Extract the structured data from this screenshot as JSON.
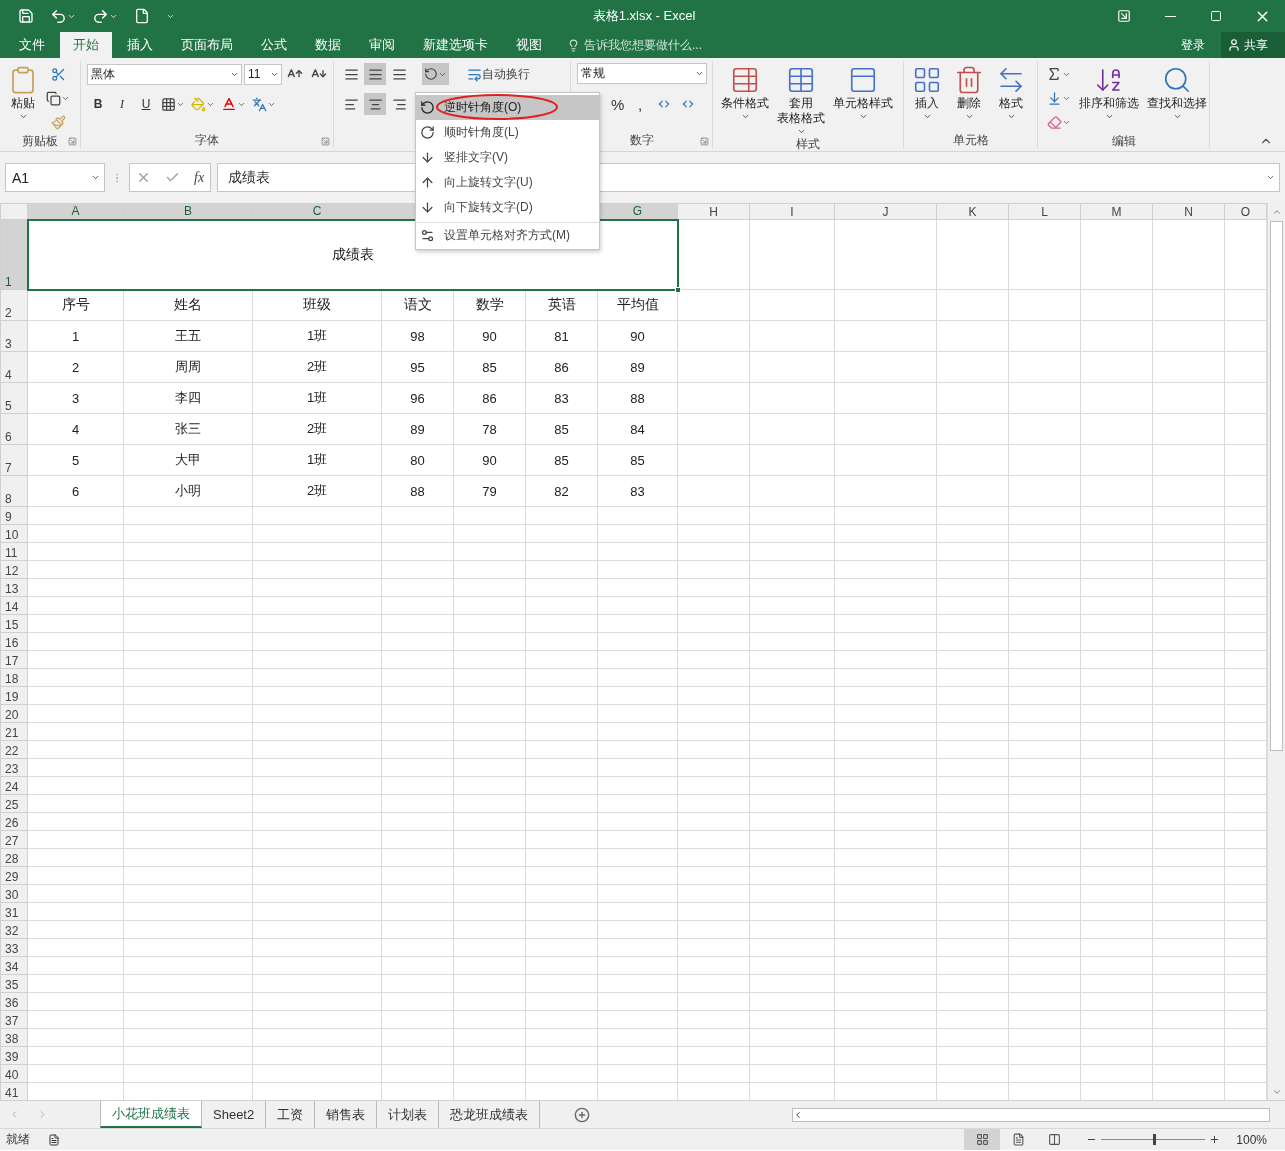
{
  "title_bar": {
    "title": "表格1.xlsx - Excel"
  },
  "menu_tabs": [
    {
      "label": "文件",
      "selected": false
    },
    {
      "label": "开始",
      "selected": true
    },
    {
      "label": "插入",
      "selected": false
    },
    {
      "label": "页面布局",
      "selected": false
    },
    {
      "label": "公式",
      "selected": false
    },
    {
      "label": "数据",
      "selected": false
    },
    {
      "label": "审阅",
      "selected": false
    },
    {
      "label": "新建选项卡",
      "selected": false
    },
    {
      "label": "视图",
      "selected": false
    }
  ],
  "tell_me": {
    "placeholder": "告诉我您想要做什么..."
  },
  "account": {
    "login": "登录",
    "share": "共享"
  },
  "ribbon": {
    "clipboard": {
      "paste": "粘贴",
      "label": "剪贴板"
    },
    "font": {
      "font_name": "黑体",
      "font_size": "11",
      "style_buttons": [
        "B",
        "I",
        "U"
      ],
      "label": "字体"
    },
    "alignment": {
      "vertical": [
        {
          "pressed": false
        },
        {
          "pressed": true
        },
        {
          "pressed": false
        }
      ],
      "horizontal": [
        {
          "pressed": false
        },
        {
          "pressed": true
        },
        {
          "pressed": false
        }
      ],
      "orientation_pressed": true,
      "wrap_text": "自动换行"
    },
    "number": {
      "format": "常规",
      "symbols": [
        "%",
        ","
      ],
      "label": "数字"
    },
    "styles": {
      "buttons": [
        {
          "kind": "conditional",
          "lines": [
            "条件格式"
          ]
        },
        {
          "kind": "table",
          "lines": [
            "套用",
            "表格格式"
          ]
        },
        {
          "kind": "cell",
          "lines": [
            "单元格样式"
          ]
        }
      ],
      "label": "样式"
    },
    "cells": {
      "buttons": [
        {
          "kind": "insert",
          "lines": [
            "插入"
          ]
        },
        {
          "kind": "delete",
          "lines": [
            "删除"
          ]
        },
        {
          "kind": "format",
          "lines": [
            "格式"
          ]
        }
      ],
      "label": "单元格"
    },
    "editing": {
      "buttons": [
        {
          "kind": "sort",
          "lines": [
            "排序和筛选"
          ]
        },
        {
          "kind": "find",
          "lines": [
            "查找和选择"
          ]
        }
      ],
      "label": "编辑"
    }
  },
  "formula_bar": {
    "name_box": "A1",
    "fx": "fx",
    "formula": "成绩表"
  },
  "orientation_menu": [
    {
      "kind": "ccw",
      "label": "逆时针角度(O)",
      "selected": true,
      "circled": true
    },
    {
      "kind": "cw",
      "label": "顺时针角度(L)",
      "selected": false,
      "circled": false
    },
    {
      "kind": "vertical",
      "label": "竖排文字(V)",
      "selected": false,
      "circled": false
    },
    {
      "kind": "up",
      "label": "向上旋转文字(U)",
      "selected": false,
      "circled": false
    },
    {
      "kind": "down",
      "label": "向下旋转文字(D)",
      "selected": false,
      "circled": false
    },
    {
      "kind": "format",
      "label": "设置单元格对齐方式(M)",
      "selected": false,
      "circled": false
    }
  ],
  "columns": [
    {
      "header": "A",
      "selected": true
    },
    {
      "header": "B",
      "selected": true
    },
    {
      "header": "C",
      "selected": true
    },
    {
      "selected": true
    },
    {},
    {},
    {
      "header": "G",
      "selected": true
    },
    {
      "header": "H",
      "selected": false
    },
    {
      "header": "I",
      "selected": false
    },
    {
      "header": "J",
      "selected": false
    },
    {
      "header": "K",
      "selected": false
    },
    {
      "header": "L",
      "selected": false
    },
    {
      "header": "M",
      "selected": false
    },
    {
      "header": "N",
      "selected": false
    },
    {
      "header": "O",
      "selected": false
    }
  ],
  "rows": [
    {
      "number": "1",
      "selected": true,
      "title": "成绩表"
    },
    {
      "number": "2",
      "selected": false,
      "cells": [
        "序号",
        "姓名",
        "班级",
        "语文",
        "数学",
        "英语",
        "平均值"
      ]
    },
    {
      "number": "3",
      "selected": false,
      "cells": [
        "1",
        "王五",
        "1班",
        "98",
        "90",
        "81",
        "90"
      ]
    },
    {
      "number": "4",
      "selected": false,
      "cells": [
        "2",
        "周周",
        "2班",
        "95",
        "85",
        "86",
        "89"
      ]
    },
    {
      "number": "5",
      "selected": false,
      "cells": [
        "3",
        "李四",
        "1班",
        "96",
        "86",
        "83",
        "88"
      ]
    },
    {
      "number": "6",
      "selected": false,
      "cells": [
        "4",
        "张三",
        "2班",
        "89",
        "78",
        "85",
        "84"
      ]
    },
    {
      "number": "7",
      "selected": false,
      "cells": [
        "5",
        "大甲",
        "1班",
        "80",
        "90",
        "85",
        "85"
      ]
    },
    {
      "number": "8",
      "selected": false,
      "cells": [
        "6",
        "小明",
        "2班",
        "88",
        "79",
        "82",
        "83"
      ]
    },
    {
      "number": "9",
      "selected": false
    },
    {
      "number": "10",
      "selected": false
    },
    {
      "number": "11",
      "selected": false
    },
    {
      "number": "12",
      "selected": false
    },
    {
      "number": "13",
      "selected": false
    },
    {
      "number": "14",
      "selected": false
    },
    {
      "number": "15",
      "selected": false
    },
    {
      "number": "16",
      "selected": false
    },
    {
      "number": "17",
      "selected": false
    },
    {
      "number": "18",
      "selected": false
    },
    {
      "number": "19",
      "selected": false
    },
    {
      "number": "20",
      "selected": false
    },
    {
      "number": "21",
      "selected": false
    },
    {
      "number": "22",
      "selected": false
    },
    {
      "number": "23",
      "selected": false
    },
    {
      "number": "24",
      "selected": false
    },
    {
      "number": "25",
      "selected": false
    },
    {
      "number": "26",
      "selected": false
    },
    {
      "number": "27",
      "selected": false
    },
    {
      "number": "28",
      "selected": false
    },
    {
      "number": "29",
      "selected": false
    },
    {
      "number": "30",
      "selected": false
    },
    {
      "number": "31",
      "selected": false
    },
    {
      "number": "32",
      "selected": false
    },
    {
      "number": "33",
      "selected": false
    },
    {
      "number": "34",
      "selected": false
    },
    {
      "number": "35",
      "selected": false
    },
    {
      "number": "36",
      "selected": false
    },
    {
      "number": "37",
      "selected": false
    },
    {
      "number": "38",
      "selected": false
    },
    {
      "number": "39",
      "selected": false
    },
    {
      "number": "40",
      "selected": false
    },
    {
      "number": "41",
      "selected": false
    }
  ],
  "sheet_tabs": [
    {
      "label": "小花班成绩表",
      "selected": true
    },
    {
      "label": "Sheet2",
      "selected": false
    },
    {
      "label": "工资",
      "selected": false
    },
    {
      "label": "销售表",
      "selected": false
    },
    {
      "label": "计划表",
      "selected": false
    },
    {
      "label": "恐龙班成绩表",
      "selected": false
    }
  ],
  "status_bar": {
    "status": "就绪",
    "zoom": "100%",
    "zoom_slider": {
      "level": 0.5
    }
  }
}
